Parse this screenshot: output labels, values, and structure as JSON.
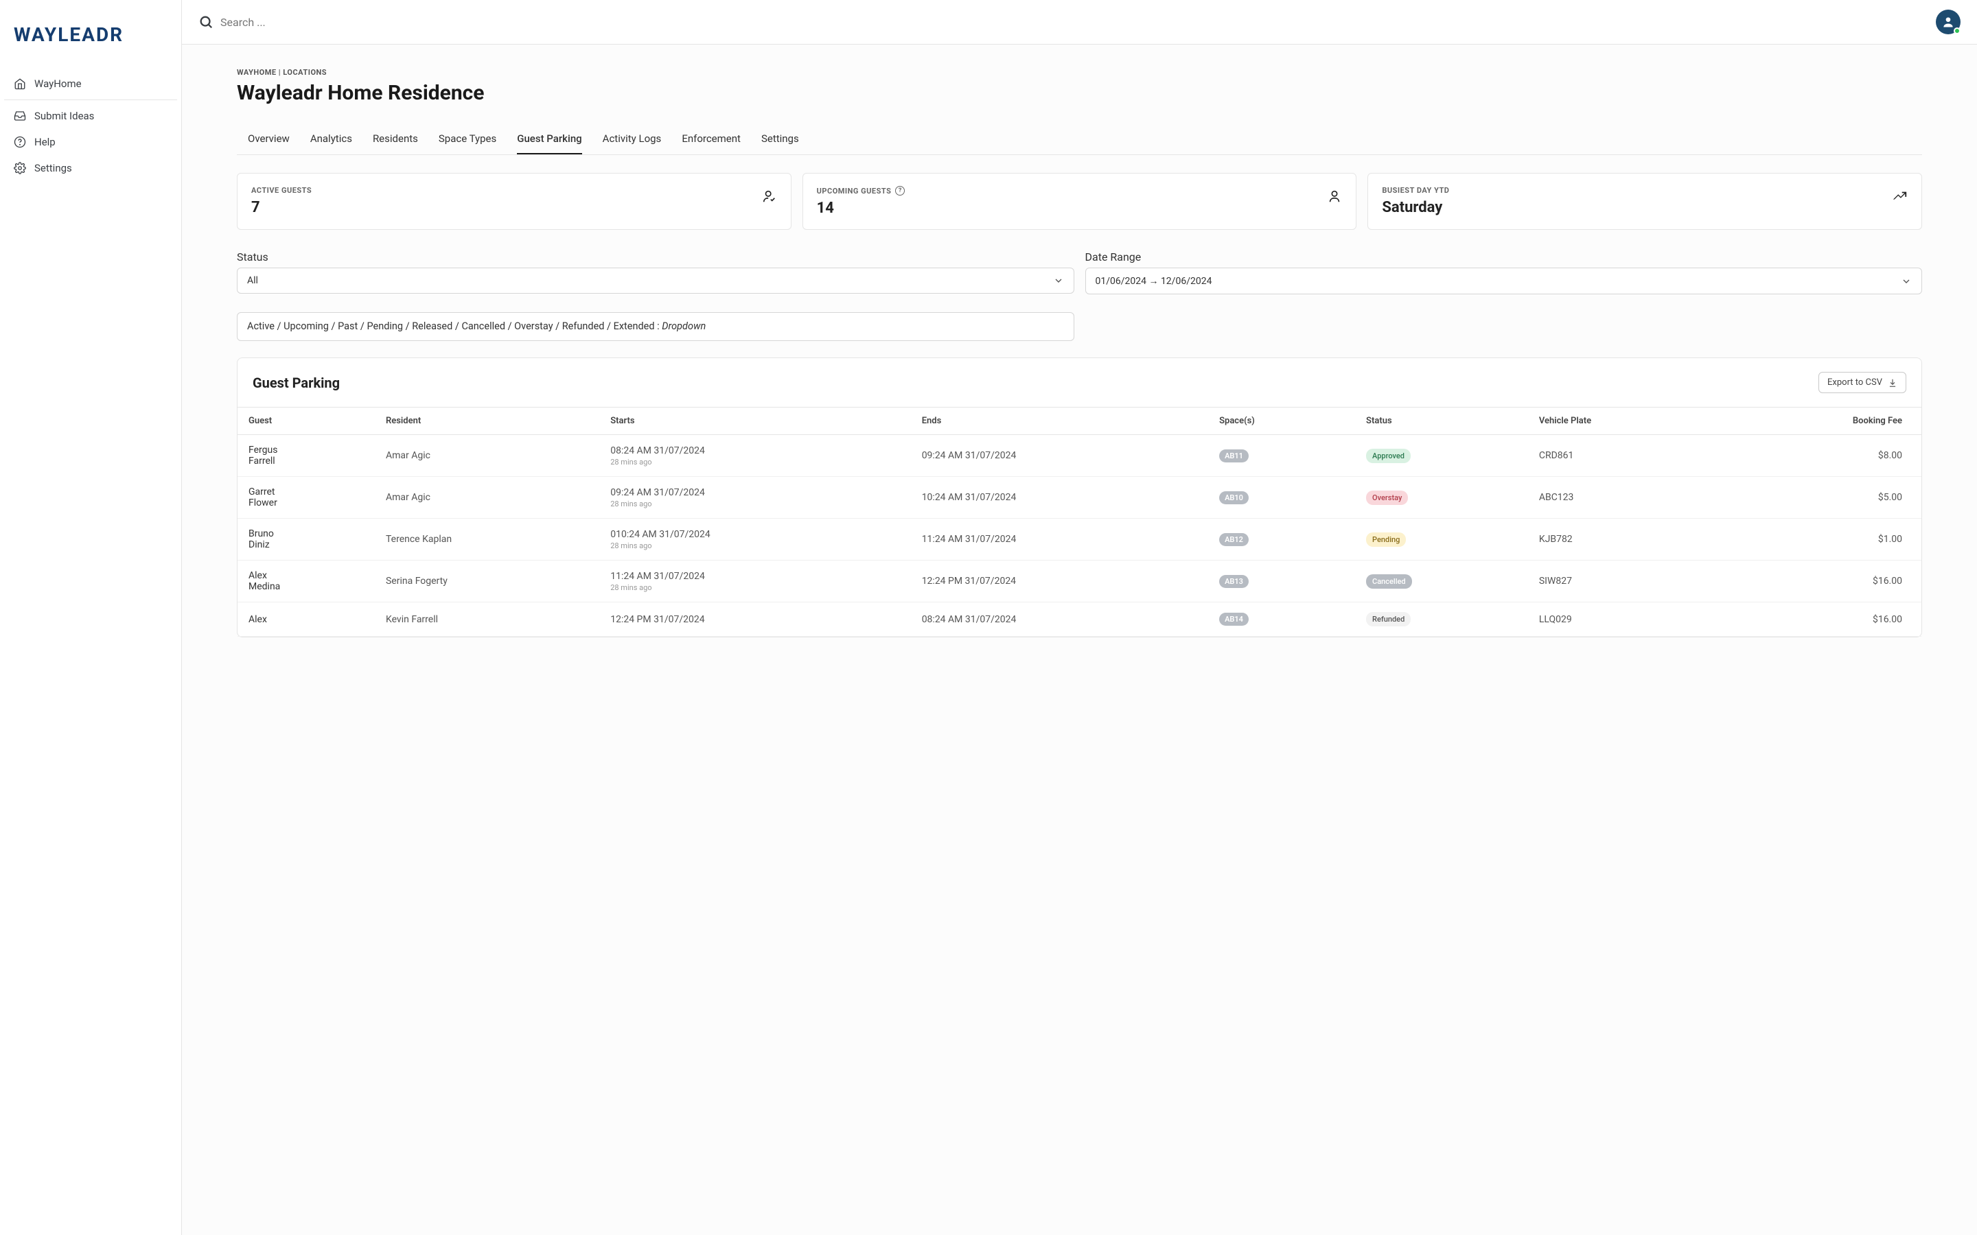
{
  "brand": "WAYLEADR",
  "sidebar": {
    "items": [
      {
        "label": "WayHome",
        "icon": "home"
      },
      {
        "label": "Submit Ideas",
        "icon": "inbox"
      },
      {
        "label": "Help",
        "icon": "help"
      },
      {
        "label": "Settings",
        "icon": "gear"
      }
    ]
  },
  "topbar": {
    "search_placeholder": "Search ..."
  },
  "breadcrumb": "WAYHOME | LOCATIONS",
  "page_title": "Wayleadr Home Residence",
  "tabs": [
    "Overview",
    "Analytics",
    "Residents",
    "Space Types",
    "Guest Parking",
    "Activity Logs",
    "Enforcement",
    "Settings"
  ],
  "active_tab_index": 4,
  "stats": {
    "active_guests": {
      "label": "ACTIVE GUESTS",
      "value": "7"
    },
    "upcoming_guests": {
      "label": "UPCOMING GUESTS",
      "value": "14"
    },
    "busiest_day": {
      "label": "BUSIEST DAY YTD",
      "value": "Saturday"
    }
  },
  "filters": {
    "status_label": "Status",
    "status_value": "All",
    "date_label": "Date Range",
    "date_value": "01/06/2024 → 12/06/2024",
    "status_options_text": "Active / Upcoming / Past / Pending / Released / Cancelled / Overstay / Refunded / Extended : ",
    "status_options_suffix": "Dropdown"
  },
  "table": {
    "title": "Guest Parking",
    "export_label": "Export to CSV",
    "columns": [
      "Guest",
      "Resident",
      "Starts",
      "Ends",
      "Space(s)",
      "Status",
      "Vehicle Plate",
      "Booking Fee"
    ],
    "rows": [
      {
        "guest": "Fergus Farrell",
        "resident": "Amar Agic",
        "starts": "08:24 AM 31/07/2024",
        "starts_sub": "28 mins ago",
        "ends": "09:24 AM 31/07/2024",
        "space": "AB11",
        "status": "Approved",
        "status_class": "approved",
        "plate": "CRD861",
        "fee": "$8.00"
      },
      {
        "guest": "Garret Flower",
        "resident": "Amar Agic",
        "starts": "09:24 AM 31/07/2024",
        "starts_sub": "28 mins ago",
        "ends": "10:24 AM 31/07/2024",
        "space": "AB10",
        "status": "Overstay",
        "status_class": "overstay",
        "plate": "ABC123",
        "fee": "$5.00"
      },
      {
        "guest": "Bruno Diniz",
        "resident": "Terence Kaplan",
        "starts": "010:24 AM 31/07/2024",
        "starts_sub": "28 mins ago",
        "ends": "11:24 AM 31/07/2024",
        "space": "AB12",
        "status": "Pending",
        "status_class": "pending",
        "plate": "KJB782",
        "fee": "$1.00"
      },
      {
        "guest": "Alex Medina",
        "resident": "Serina Fogerty",
        "starts": "11:24 AM 31/07/2024",
        "starts_sub": "28 mins ago",
        "ends": "12:24 PM 31/07/2024",
        "space": "AB13",
        "status": "Cancelled",
        "status_class": "cancelled",
        "plate": "SIW827",
        "fee": "$16.00"
      },
      {
        "guest": "Alex",
        "resident": "Kevin Farrell",
        "starts": "12:24 PM 31/07/2024",
        "starts_sub": "",
        "ends": "08:24 AM 31/07/2024",
        "space": "AB14",
        "status": "Refunded",
        "status_class": "refunded",
        "plate": "LLQ029",
        "fee": "$16.00"
      }
    ]
  }
}
